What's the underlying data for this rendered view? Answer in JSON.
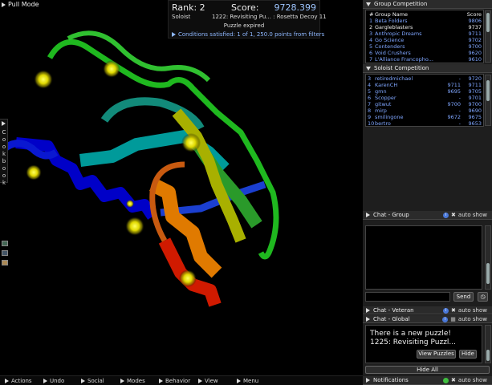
{
  "viewport": {
    "pull_mode_label": "Pull Mode",
    "rank_text": "Rank: 2",
    "score_label": "Score:",
    "score_value": "9728.399",
    "role": "Soloist",
    "puzzle_title": "1222: Revisiting Pu... : Rosetta Decoy 11",
    "status": "Puzzle expired",
    "conditions": "Conditions satisfied: 1 of 1, 250.0 points from filters",
    "cookbook_label": "Cookbook"
  },
  "bottom_menu": [
    {
      "label": "Actions"
    },
    {
      "label": "Undo"
    },
    {
      "label": "Social"
    },
    {
      "label": "Modes"
    },
    {
      "label": "Behavior"
    },
    {
      "label": "View"
    },
    {
      "label": "Menu"
    }
  ],
  "group_competition": {
    "title": "Group Competition",
    "header": {
      "num": "#",
      "name": "Group Name",
      "score": "Score"
    },
    "rows": [
      {
        "num": "1",
        "name": "Beta Folders",
        "score": "9806",
        "highlight": false
      },
      {
        "num": "2",
        "name": "Gargleblasters",
        "score": "9737",
        "highlight": true
      },
      {
        "num": "3",
        "name": "Anthropic Dreams",
        "score": "9711",
        "highlight": false
      },
      {
        "num": "4",
        "name": "Go Science",
        "score": "9702",
        "highlight": false
      },
      {
        "num": "5",
        "name": "Contenders",
        "score": "9700",
        "highlight": false
      },
      {
        "num": "6",
        "name": "Void Crushers",
        "score": "9620",
        "highlight": false
      },
      {
        "num": "7",
        "name": "L'Alliance Francopho...",
        "score": "9610",
        "highlight": false
      }
    ]
  },
  "soloist_competition": {
    "title": "Soloist Competition",
    "rows": [
      {
        "num": "3",
        "name": "retiredmichael",
        "a": "-",
        "b": "9720"
      },
      {
        "num": "4",
        "name": "KarenCH",
        "a": "9711",
        "b": "9711"
      },
      {
        "num": "5",
        "name": "gmn",
        "a": "9695",
        "b": "9705"
      },
      {
        "num": "6",
        "name": "Scopper",
        "a": "-",
        "b": "9701"
      },
      {
        "num": "7",
        "name": "gitwut",
        "a": "9700",
        "b": "9700"
      },
      {
        "num": "8",
        "name": "mirp",
        "a": "-",
        "b": "9690"
      },
      {
        "num": "9",
        "name": "smilingone",
        "a": "9672",
        "b": "9675"
      },
      {
        "num": "10",
        "name": "bertro",
        "a": "-",
        "b": "9653"
      }
    ]
  },
  "chat_group": {
    "title": "Chat - Group",
    "auto_show": "auto show",
    "send_label": "Send"
  },
  "chat_veteran": {
    "title": "Chat - Veteran",
    "auto_show": "auto show"
  },
  "chat_global": {
    "title": "Chat - Global",
    "auto_show": "auto show"
  },
  "notification": {
    "line1": "There is a new puzzle!",
    "line2": "1225: Revisiting Puzzl...",
    "view_label": "View Puzzles",
    "hide_label": "Hide",
    "hide_all_label": "Hide All",
    "title": "Notifications",
    "auto_show": "auto show"
  },
  "colors": {
    "score_blue": "#9fc6ff",
    "list_blue": "#7fa6ff",
    "panel_bg": "#1e1e1e",
    "header_bg": "#2b2b2b",
    "glow_yellow": "#e8e000",
    "notif_green": "#3fbf3f"
  }
}
